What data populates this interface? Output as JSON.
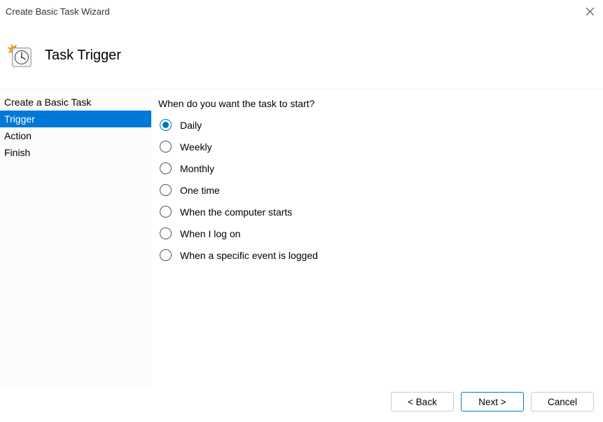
{
  "window": {
    "title": "Create Basic Task Wizard"
  },
  "header": {
    "title": "Task Trigger"
  },
  "sidebar": {
    "items": [
      {
        "label": "Create a Basic Task",
        "selected": false
      },
      {
        "label": "Trigger",
        "selected": true
      },
      {
        "label": "Action",
        "selected": false
      },
      {
        "label": "Finish",
        "selected": false
      }
    ]
  },
  "main": {
    "prompt": "When do you want the task to start?",
    "options": [
      {
        "label": "Daily",
        "checked": true
      },
      {
        "label": "Weekly",
        "checked": false
      },
      {
        "label": "Monthly",
        "checked": false
      },
      {
        "label": "One time",
        "checked": false
      },
      {
        "label": "When the computer starts",
        "checked": false
      },
      {
        "label": "When I log on",
        "checked": false
      },
      {
        "label": "When a specific event is logged",
        "checked": false
      }
    ]
  },
  "footer": {
    "back_label": "< Back",
    "next_label": "Next >",
    "cancel_label": "Cancel"
  }
}
